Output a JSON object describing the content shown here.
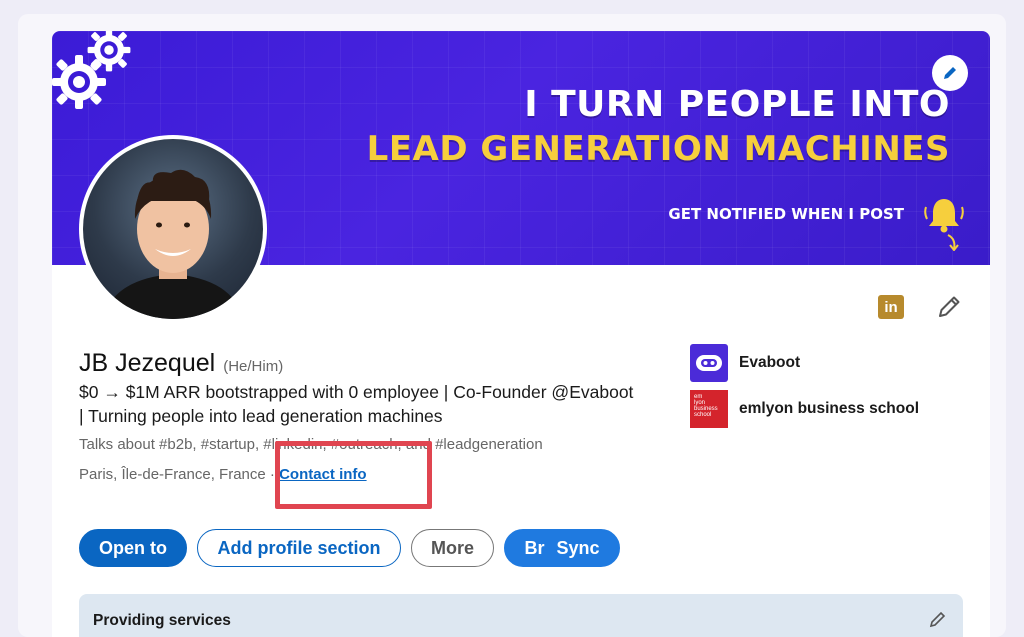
{
  "banner": {
    "line1": "I TURN PEOPLE INTO",
    "line2": "LEAD GENERATION MACHINES",
    "line3": "GET NOTIFIED WHEN I POST"
  },
  "profile": {
    "name": "JB Jezequel",
    "pronouns": "(He/Him)",
    "headline": "$0 → $1M ARR bootstrapped with 0 employee | Co-Founder @Evaboot | Turning people into lead generation machines",
    "talks_about": "Talks about #b2b, #startup, #linkedin, #outreach, and #leadgeneration",
    "location": "Paris, Île-de-France, France",
    "location_separator": " · ",
    "contact_info": "Contact info",
    "linkedin_badge": "in"
  },
  "companies": [
    {
      "name": "Evaboot",
      "logo_icon": "evaboot-robot-logo"
    },
    {
      "name": "emlyon business school",
      "logo_icon": "emlyon-logo",
      "logo_text": "em lyon business school"
    }
  ],
  "actions": {
    "open_to": "Open to",
    "add_section": "Add profile section",
    "more": "More",
    "sync_prefix": "Br",
    "sync": "Sync"
  },
  "services": {
    "title": "Providing services"
  },
  "colors": {
    "banner_bg": "#3b1bd6",
    "banner_highlight": "#f6cf3d",
    "linkedin_blue": "#0a66c2",
    "highlight_red": "#e04550",
    "evaboot_purple": "#4b2bd8",
    "emlyon_red": "#d4242c"
  }
}
